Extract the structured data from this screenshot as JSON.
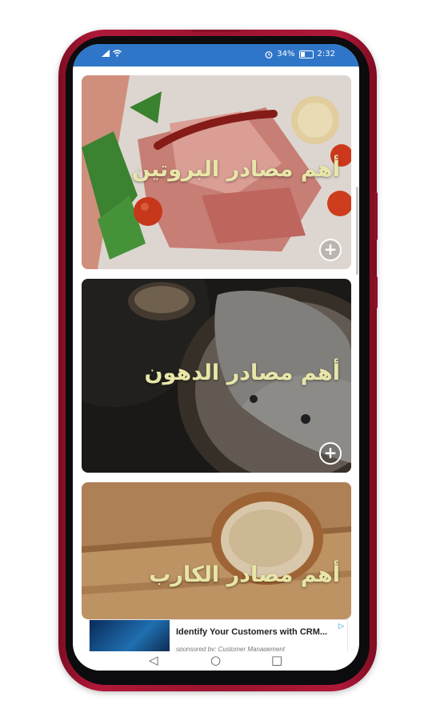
{
  "status_bar": {
    "battery_text": "34%",
    "battery_level": 0.34,
    "time": "2:32",
    "icons": [
      "signal-icon",
      "wifi-icon",
      "alarm-icon",
      "battery-icon"
    ]
  },
  "cards": [
    {
      "title": "أهم مصادر البروتين",
      "action_icon": "plus-circle-icon"
    },
    {
      "title": "أهم مصادر الدهون",
      "action_icon": "plus-circle-icon"
    },
    {
      "title": "أهم مصادر الكارب"
    }
  ],
  "ad": {
    "title": "Identify Your Customers with CRM...",
    "sponsor": "sponsored by: Customer Management",
    "choice_icon": "adchoices-icon"
  },
  "nav": {
    "back": "◁",
    "home": "○",
    "recents": "□"
  },
  "colors": {
    "status_bar": "#2f76c9",
    "phone_frame": "#9a1430",
    "title_text": "#e8e6a8"
  }
}
